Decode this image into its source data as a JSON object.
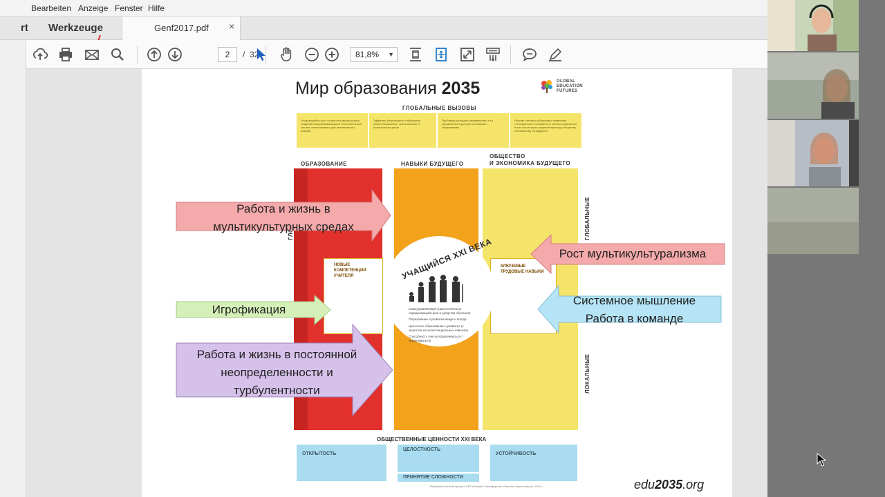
{
  "menubar": {
    "items": [
      "Bearbeiten",
      "Anzeige",
      "Fenster",
      "Hilfe"
    ]
  },
  "tabs": {
    "start_label": "rt",
    "tools_label": "Werkzeuge",
    "doc_label": "Genf2017.pdf",
    "close_glyph": "×"
  },
  "toolbar": {
    "page_current": "2",
    "page_separator": "/",
    "page_total": "32",
    "zoom": "81,8%",
    "zoom_arrow": "▼",
    "icons": [
      "upload-icon",
      "print-icon",
      "mail-icon",
      "search-icon",
      "page-up-icon",
      "page-down-icon",
      "select-arrow-icon",
      "hand-icon",
      "zoom-out-icon",
      "zoom-in-icon",
      "crop-icon",
      "fit-page-icon",
      "fullscreen-icon",
      "scroll-mode-icon",
      "comment-icon",
      "highlight-icon"
    ]
  },
  "pdf": {
    "title_prefix": "Мир образования",
    "title_year": "2035",
    "logo_lines": [
      "GLOBAL",
      "EDUCATION",
      "FUTURES"
    ],
    "global_challenges": "ГЛОБАЛЬНЫЕ ВЫЗОВЫ",
    "challenges": [
      "Ускоряющийся рост сложности (включая риск создания саморазвивающихся технологических систем, непостижимых для человеческого разума)",
      "Эффекты Антропоцена: глобальные экзистенциальные, экологические и политические риски",
      "Проблема растущего неравенства, в т.ч. неравенство в доступе к знаниям и образованию",
      "Рассвет сетевого общества и появление «ноосферных» сообществ и систем управления, в том числе через мировой переход к обществу, основанному на мудрости"
    ],
    "col_education": "ОБРАЗОВАНИЕ",
    "col_skills": "НАВЫКИ БУДУЩЕГО",
    "col_society_1": "ОБЩЕСТВО",
    "col_society_2": "И ЭКОНОМИКА БУДУЩЕГО",
    "vertical_global": "ГЛОБАЛЬНЫЕ",
    "vertical_local": "ЛОКАЛЬНЫЕ",
    "vertical_left": "ГЛОБ",
    "center_title": "УЧАЩИЙСЯ XXI ВЕКА",
    "center_items": [
      "Самоуправляемый (самостоятельно определяющий цели и средства обучения)",
      "Образование и развитие везде и всегда",
      "Целостное образование и развитие (с акцентом на экзистенциальных навыках)",
      "Способность учиться (разучиваться / переучиваться)"
    ],
    "card_left_1": "НОВЫЕ",
    "card_left_2": "КОМПЕТЕНЦИИ",
    "card_left_3": "УЧИТЕЛЯ",
    "card_right_1": "КЛЮЧЕВЫЕ",
    "card_right_2": "ТРУДОВЫЕ НАВЫКИ",
    "bottom_title": "ОБЩЕСТВЕННЫЕ ЦЕННОСТИ XXI ВЕКА",
    "value_open": "ОТКРЫТОСТЬ",
    "value_whole": "ЦЕЛОСТНОСТЬ",
    "value_sustain": "УСТОЙЧИВОСТЬ",
    "value_complex": "ПРИНЯТИЕ СЛОЖНОСТИ",
    "footnote": "Результаты сессий проекта GEF в Казани, Калифорнии и Вероне, апрель-август 2016 г.",
    "edu_logo_prefix": "edu",
    "edu_logo_bold": "2035",
    "edu_logo_suffix": ".org"
  },
  "callouts": {
    "multicultural_work_1": "Работа и жизнь в",
    "multicultural_work_2": "мультикультурных средах",
    "multicultural_growth": "Рост мультикультурализма",
    "gamification": "Игрофикация",
    "systems_1": "Системное мышление",
    "systems_2": "Работа в команде",
    "uncertainty_1": "Работа и жизнь в постоянной",
    "uncertainty_2": "неопределенности и",
    "uncertainty_3": "турбулентности"
  },
  "colors": {
    "red_column": "#e2312d",
    "orange_column": "#f3a21b",
    "yellow_column": "#f4e46a",
    "blue_values": "#a9dcf1",
    "callout_pink": "#f4a9aa",
    "callout_green": "#d4f0b8",
    "callout_blue": "#b5e4f6",
    "callout_purple": "#d5c1ea"
  }
}
